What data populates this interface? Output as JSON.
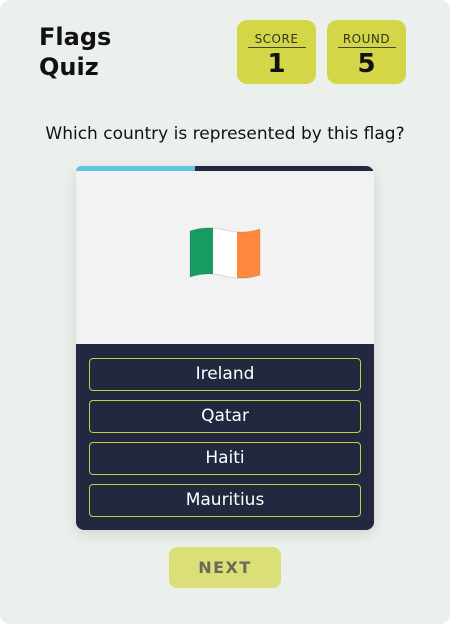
{
  "header": {
    "title_line1": "Flags",
    "title_line2": "Quiz"
  },
  "stats": {
    "score_label": "SCORE",
    "score_value": "1",
    "round_label": "ROUND",
    "round_value": "5"
  },
  "question": "Which country is represented by this flag?",
  "progress": {
    "fraction": 0.4,
    "color": "#5fc4e0"
  },
  "flag": {
    "icon": "ireland-flag-icon",
    "colors": [
      "#169b62",
      "#ffffff",
      "#ff883e"
    ]
  },
  "options": [
    "Ireland",
    "Qatar",
    "Haiti",
    "Mauritius"
  ],
  "next_label": "NEXT",
  "colors": {
    "accent": "#d3d646",
    "card": "#222840",
    "background": "#ebf0ec"
  }
}
